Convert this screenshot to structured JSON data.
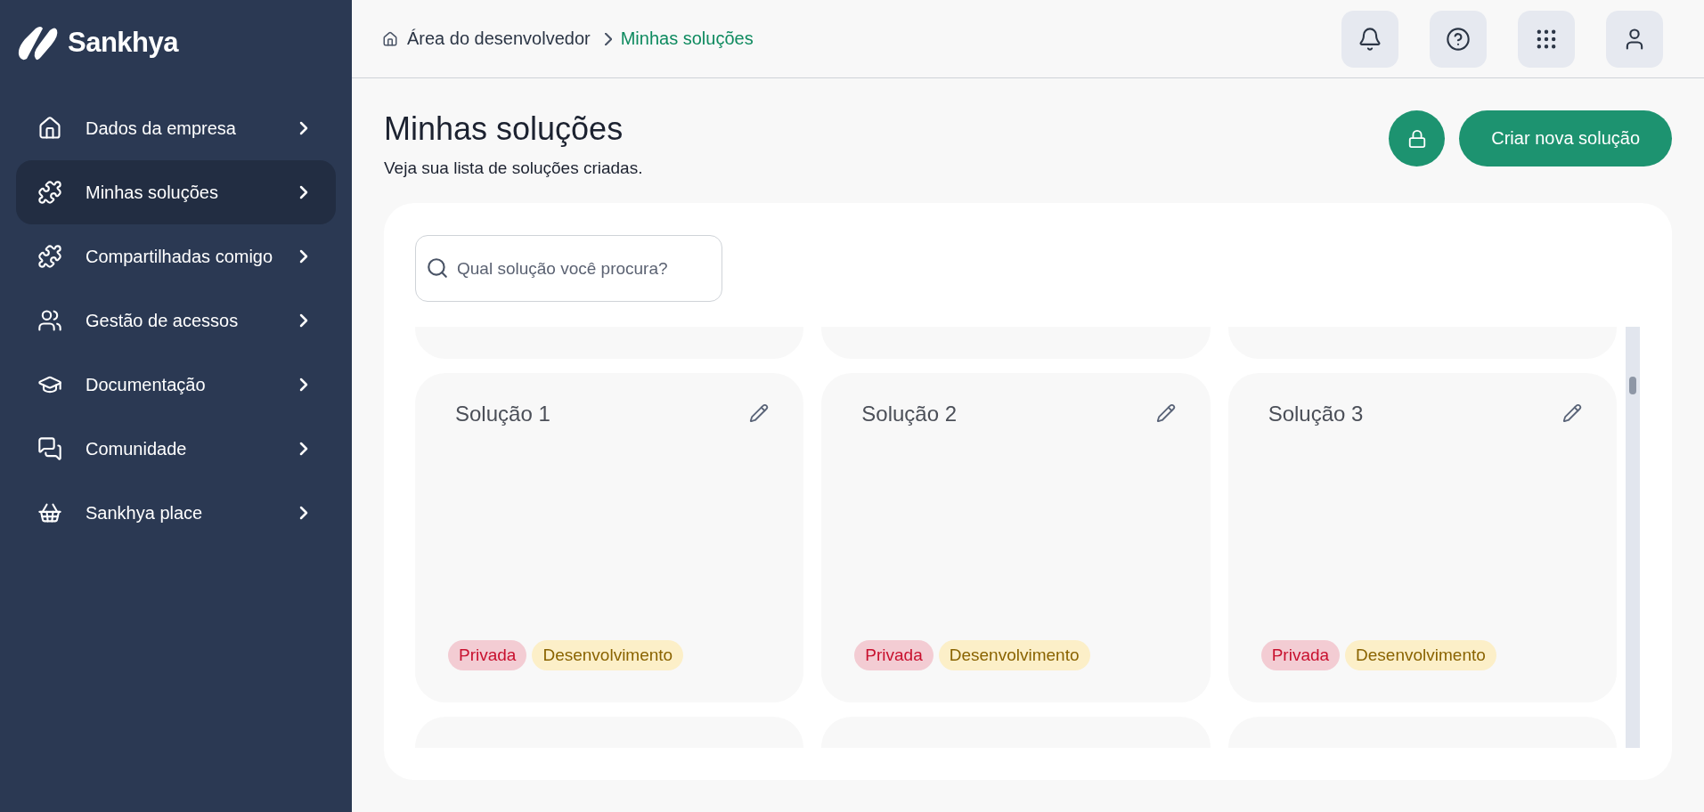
{
  "brand": {
    "name": "Sankhya"
  },
  "sidebar": {
    "items": [
      {
        "label": "Dados da empresa",
        "selected": false
      },
      {
        "label": "Minhas soluções",
        "selected": true
      },
      {
        "label": "Compartilhadas comigo",
        "selected": false
      },
      {
        "label": "Gestão de acessos",
        "selected": false
      },
      {
        "label": "Documentação",
        "selected": false
      },
      {
        "label": "Comunidade",
        "selected": false
      },
      {
        "label": "Sankhya place",
        "selected": false
      }
    ]
  },
  "breadcrumb": [
    {
      "label": "Área do desenvolvedor",
      "current": false
    },
    {
      "label": "Minhas soluções",
      "current": true
    }
  ],
  "page": {
    "title": "Minhas soluções",
    "subtitle": "Veja sua lista de soluções criadas.",
    "primary_button": "Criar nova solução"
  },
  "search": {
    "placeholder": "Qual solução você procura?"
  },
  "solutions": [
    {
      "title": "Solução 1",
      "tags": [
        {
          "label": "Privada",
          "kind": "privacy"
        },
        {
          "label": "Desenvolvimento",
          "kind": "stage"
        }
      ]
    },
    {
      "title": "Solução 2",
      "tags": [
        {
          "label": "Privada",
          "kind": "privacy"
        },
        {
          "label": "Desenvolvimento",
          "kind": "stage"
        }
      ]
    },
    {
      "title": "Solução 3",
      "tags": [
        {
          "label": "Privada",
          "kind": "privacy"
        },
        {
          "label": "Desenvolvimento",
          "kind": "stage"
        }
      ]
    }
  ]
}
